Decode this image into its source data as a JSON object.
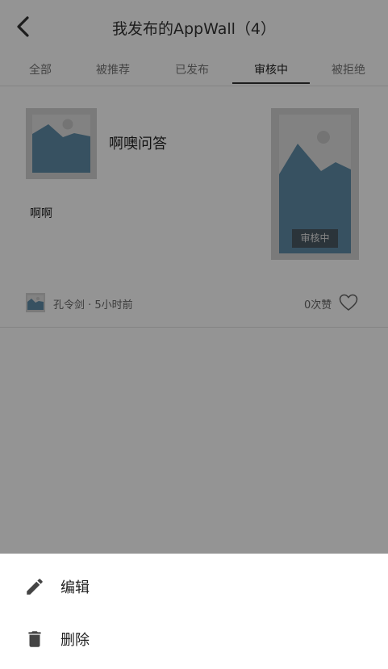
{
  "header": {
    "title": "我发布的AppWall（4）",
    "back_icon": "chevron-left-icon"
  },
  "tabs": [
    {
      "label": "全部",
      "active": false
    },
    {
      "label": "被推荐",
      "active": false
    },
    {
      "label": "已发布",
      "active": false
    },
    {
      "label": "审核中",
      "active": true
    },
    {
      "label": "被拒绝",
      "active": false
    }
  ],
  "post": {
    "title": "啊噢问答",
    "body": "啊啊",
    "status_badge": "审核中",
    "author_time": "孔令剑 · 5小时前",
    "likes": "0次赞"
  },
  "action_sheet": {
    "edit_label": "编辑",
    "delete_label": "删除"
  },
  "colors": {
    "image_placeholder": "#5f8ca8",
    "image_frame": "#d2d2d2",
    "overlay": "rgba(0,0,0,0.42)"
  }
}
